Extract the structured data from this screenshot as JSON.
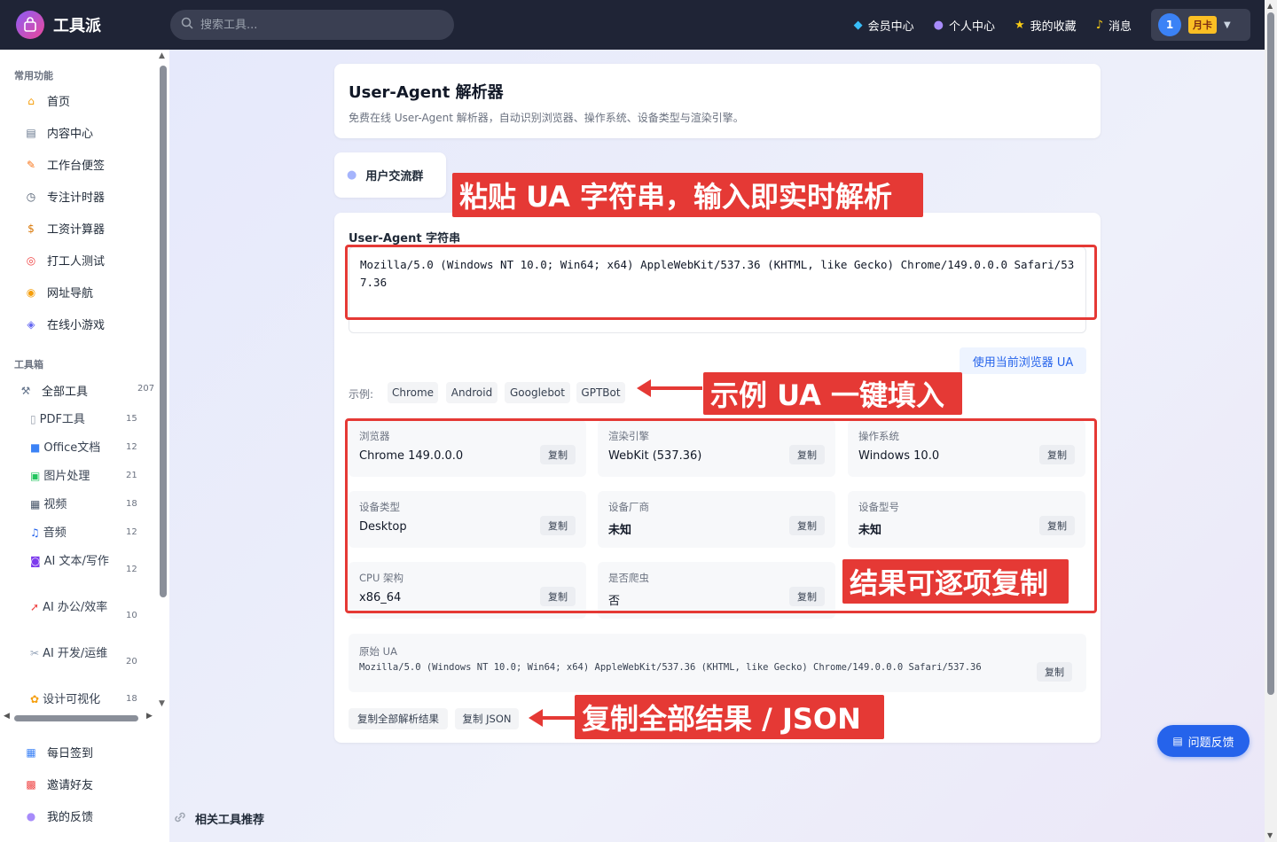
{
  "brand": {
    "name": "工具派"
  },
  "search": {
    "placeholder": "搜索工具..."
  },
  "nav": [
    {
      "label": "会员中心",
      "icon": "diamond-icon"
    },
    {
      "label": "个人中心",
      "icon": "user-icon"
    },
    {
      "label": "我的收藏",
      "icon": "star-icon"
    },
    {
      "label": "消息",
      "icon": "bell-icon"
    }
  ],
  "user": {
    "avatar": "1",
    "badge": "月卡"
  },
  "sidebar": {
    "section_common": "常用功能",
    "common": [
      "首页",
      "内容中心",
      "工作台便签",
      "专注计时器",
      "工资计算器",
      "打工人测试",
      "网址导航",
      "在线小游戏"
    ],
    "section_tools": "工具箱",
    "all_tools": {
      "label": "全部工具",
      "count": "207"
    },
    "categories": [
      {
        "label": "PDF工具",
        "count": "15"
      },
      {
        "label": "Office文档",
        "count": "12"
      },
      {
        "label": "图片处理",
        "count": "21"
      },
      {
        "label": "视频",
        "count": "18"
      },
      {
        "label": "音频",
        "count": "12"
      },
      {
        "label": "AI 文本/写作",
        "count": "12"
      },
      {
        "label": "AI 办公/效率",
        "count": "10"
      },
      {
        "label": "AI 开发/运维",
        "count": "20"
      },
      {
        "label": "设计可视化",
        "count": "18"
      }
    ],
    "bottom": [
      "每日签到",
      "邀请好友",
      "我的反馈"
    ]
  },
  "header_card": {
    "title": "User-Agent 解析器",
    "desc": "免费在线 User-Agent 解析器，自动识别浏览器、操作系统、设备类型与渲染引擎。"
  },
  "group_button": "用户交流群",
  "ua": {
    "label": "User-Agent 字符串",
    "value": "Mozilla/5.0 (Windows NT 10.0; Win64; x64) AppleWebKit/537.36 (KHTML, like Gecko) Chrome/149.0.0.0 Safari/537.36",
    "use_current": "使用当前浏览器 UA"
  },
  "examples": {
    "label": "示例:",
    "items": [
      "Chrome",
      "Android",
      "Googlebot",
      "GPTBot"
    ]
  },
  "copy_label": "复制",
  "results": [
    {
      "key": "浏览器",
      "value": "Chrome 149.0.0.0",
      "bold": false
    },
    {
      "key": "渲染引擎",
      "value": "WebKit (537.36)",
      "bold": false
    },
    {
      "key": "操作系统",
      "value": "Windows 10.0",
      "bold": false
    },
    {
      "key": "设备类型",
      "value": "Desktop",
      "bold": false
    },
    {
      "key": "设备厂商",
      "value": "未知",
      "bold": true
    },
    {
      "key": "设备型号",
      "value": "未知",
      "bold": true
    },
    {
      "key": "CPU 架构",
      "value": "x86_64",
      "bold": false
    },
    {
      "key": "是否爬虫",
      "value": "否",
      "bold": false
    }
  ],
  "raw": {
    "label": "原始 UA",
    "value": "Mozilla/5.0 (Windows NT 10.0; Win64; x64) AppleWebKit/537.36 (KHTML, like Gecko) Chrome/149.0.0.0 Safari/537.36"
  },
  "actions": {
    "copy_all": "复制全部解析结果",
    "copy_json": "复制 JSON"
  },
  "annotations": {
    "paste": "粘贴 UA 字符串，输入即实时解析",
    "examples": "示例 UA 一键填入",
    "copy_each": "结果可逐项复制",
    "copy_all": "复制全部结果 / JSON"
  },
  "feedback": "问题反馈",
  "related": "相关工具推荐",
  "colors": {
    "accent": "#2563eb",
    "annotation": "#e53935",
    "header": "#1f2436"
  }
}
